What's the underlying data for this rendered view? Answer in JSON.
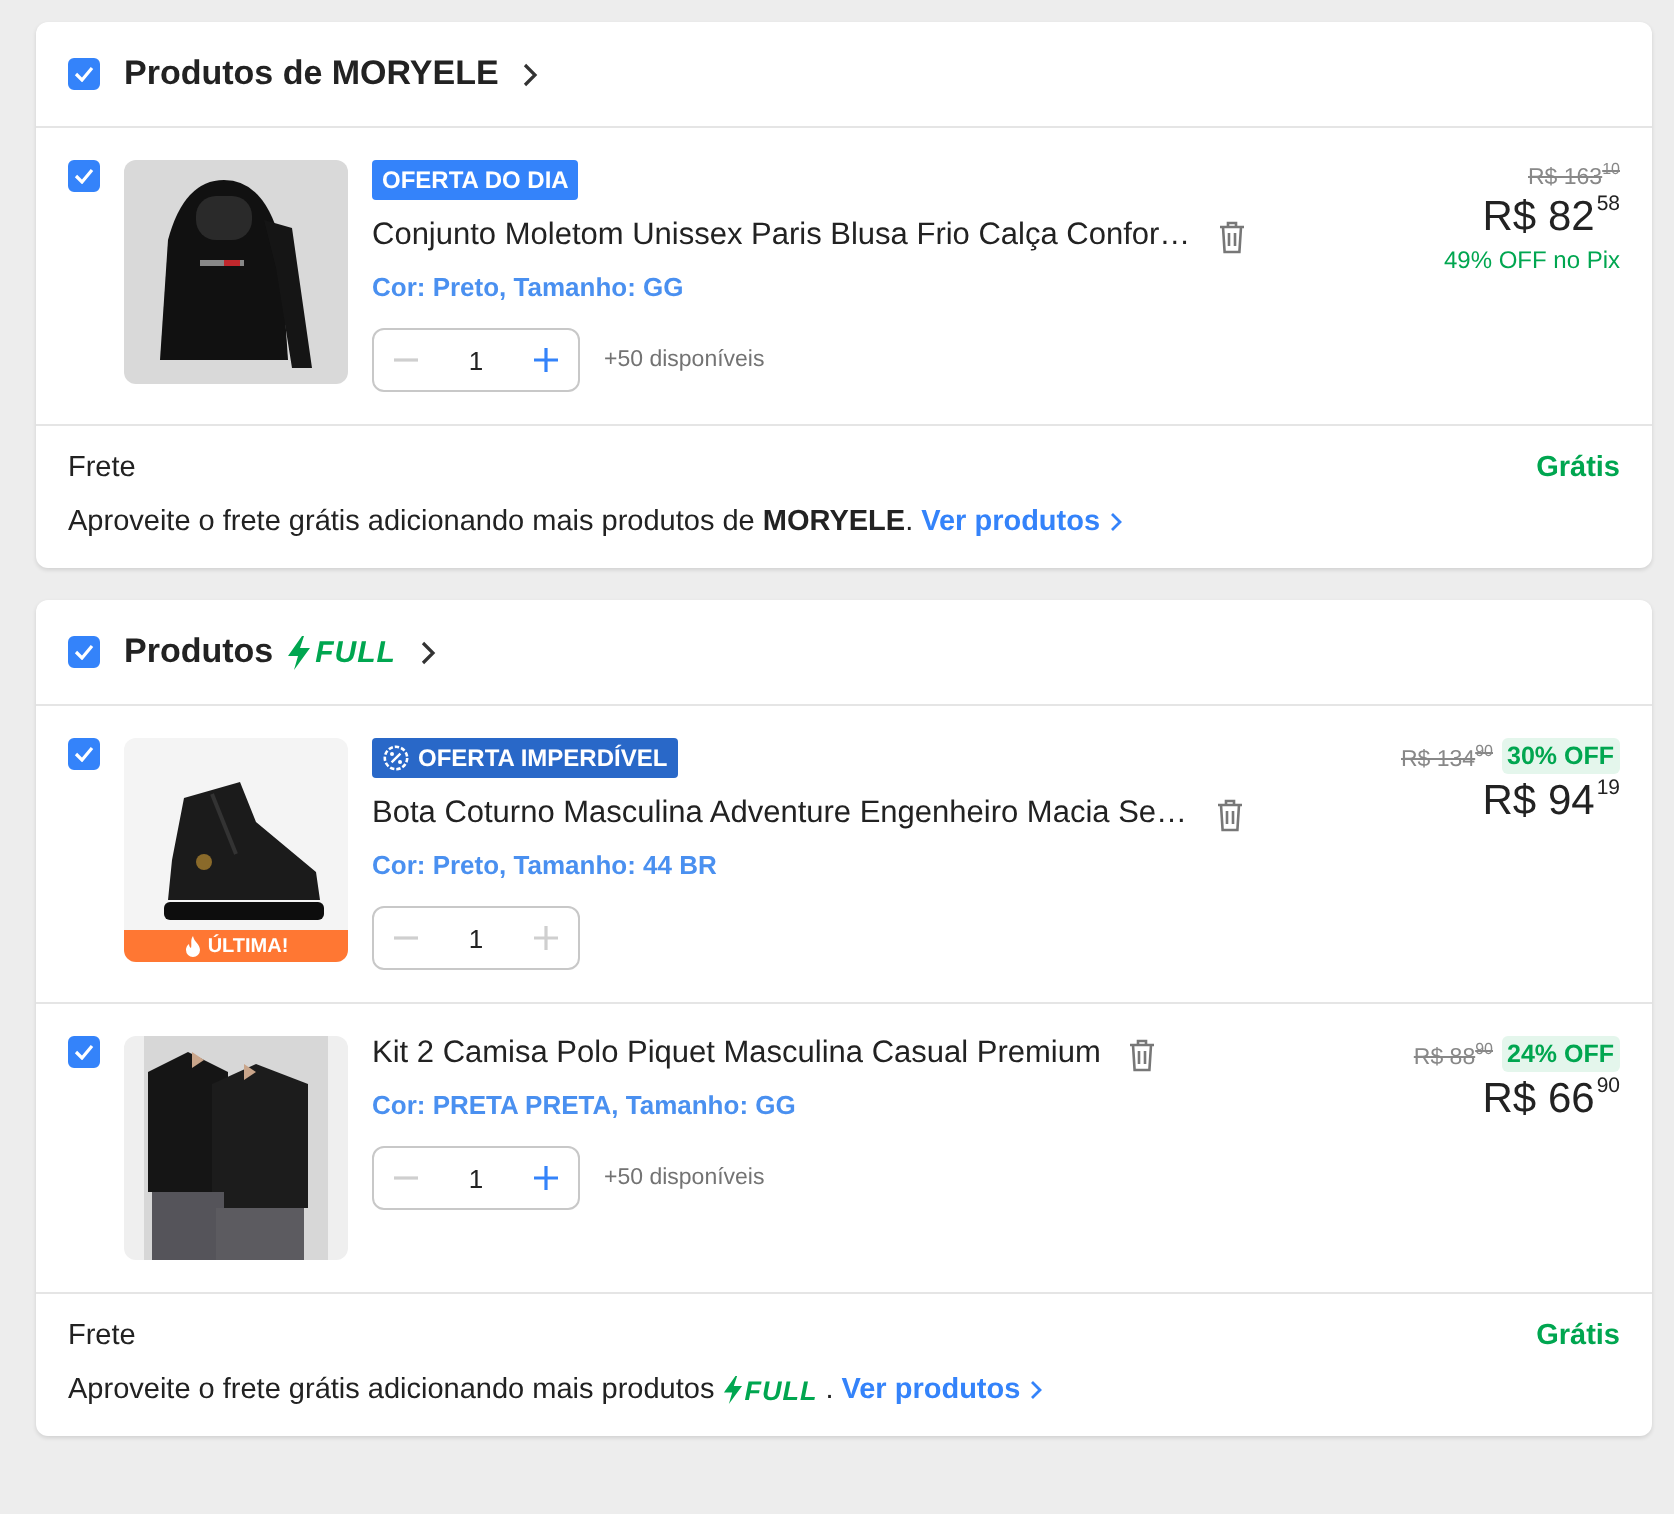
{
  "sections": [
    {
      "checked": true,
      "title": "Produtos de MORYELE",
      "items": [
        {
          "checked": true,
          "badge": {
            "kind": "day",
            "label": "OFERTA DO DIA"
          },
          "name": "Conjunto Moletom Unissex Paris Blusa Frio Calça Confor…",
          "variant": "Cor: Preto, Tamanho: GG",
          "quantity": "1",
          "minus_disabled": true,
          "plus_disabled": false,
          "stock": "+50 disponíveis",
          "old_price": "R$ 163",
          "old_cents": "10",
          "price": "R$ 82",
          "cents": "58",
          "discount": {
            "kind": "pix",
            "text": "49% OFF no Pix"
          }
        }
      ],
      "shipping": {
        "label": "Frete",
        "value": "Grátis",
        "message": "Aproveite o frete grátis adicionando mais produtos de **MORYELE**.",
        "link": "Ver produtos"
      }
    },
    {
      "checked": true,
      "title": "Produtos",
      "logo": "FULL",
      "items": [
        {
          "checked": true,
          "image_label": "ÚLTIMA!",
          "badge": {
            "kind": "deal",
            "label": "OFERTA IMPERDÍVEL"
          },
          "name": "Bota Coturno Masculina Adventure Engenheiro Macia Se…",
          "variant": "Cor: Preto, Tamanho: 44 BR",
          "quantity": "1",
          "minus_disabled": true,
          "plus_disabled": true,
          "old_price": "R$ 134",
          "old_cents": "90",
          "price": "R$ 94",
          "cents": "19",
          "discount": {
            "kind": "tag",
            "text": "30% OFF"
          }
        },
        {
          "checked": true,
          "name": "Kit 2 Camisa Polo Piquet Masculina Casual Premium",
          "variant": "Cor: PRETA PRETA, Tamanho: GG",
          "quantity": "1",
          "minus_disabled": true,
          "plus_disabled": false,
          "stock": "+50 disponíveis",
          "old_price": "R$ 88",
          "old_cents": "90",
          "price": "R$ 66",
          "cents": "90",
          "discount": {
            "kind": "tag",
            "text": "24% OFF"
          }
        }
      ],
      "shipping": {
        "label": "Frete",
        "value": "Grátis",
        "message": "Aproveite o frete grátis adicionando mais produtos",
        "logo": "FULL",
        "message_end": ".",
        "link": "Ver produtos"
      }
    }
  ]
}
